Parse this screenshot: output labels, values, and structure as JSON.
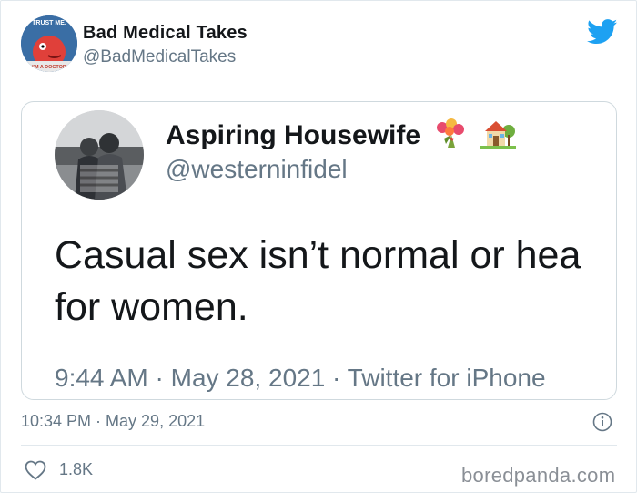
{
  "author": {
    "name": "Bad Medical Takes",
    "handle": "@BadMedicalTakes",
    "avatar_icon": "cartoon-doctor-avatar",
    "avatar_text_top": "TRUST ME.",
    "avatar_text_bottom": "I'M A DOCTOR"
  },
  "platform_icon": "twitter-bird-icon",
  "brand_color": "#1da1f2",
  "quoted_tweet": {
    "name": "Aspiring Housewife",
    "name_emojis": [
      "bouquet-emoji",
      "house-with-garden-emoji"
    ],
    "handle": "@westerninfidel",
    "text": "Casual sex isn’t normal or hea\nfor women.",
    "meta": "9:44 AM · May 28, 2021 · Twitter for iPhone"
  },
  "timestamp": "10:34 PM · May 29, 2021",
  "info_icon": "info-icon",
  "likes": {
    "icon": "heart-icon",
    "count": "1.8K"
  },
  "watermark": "boredpanda.com"
}
